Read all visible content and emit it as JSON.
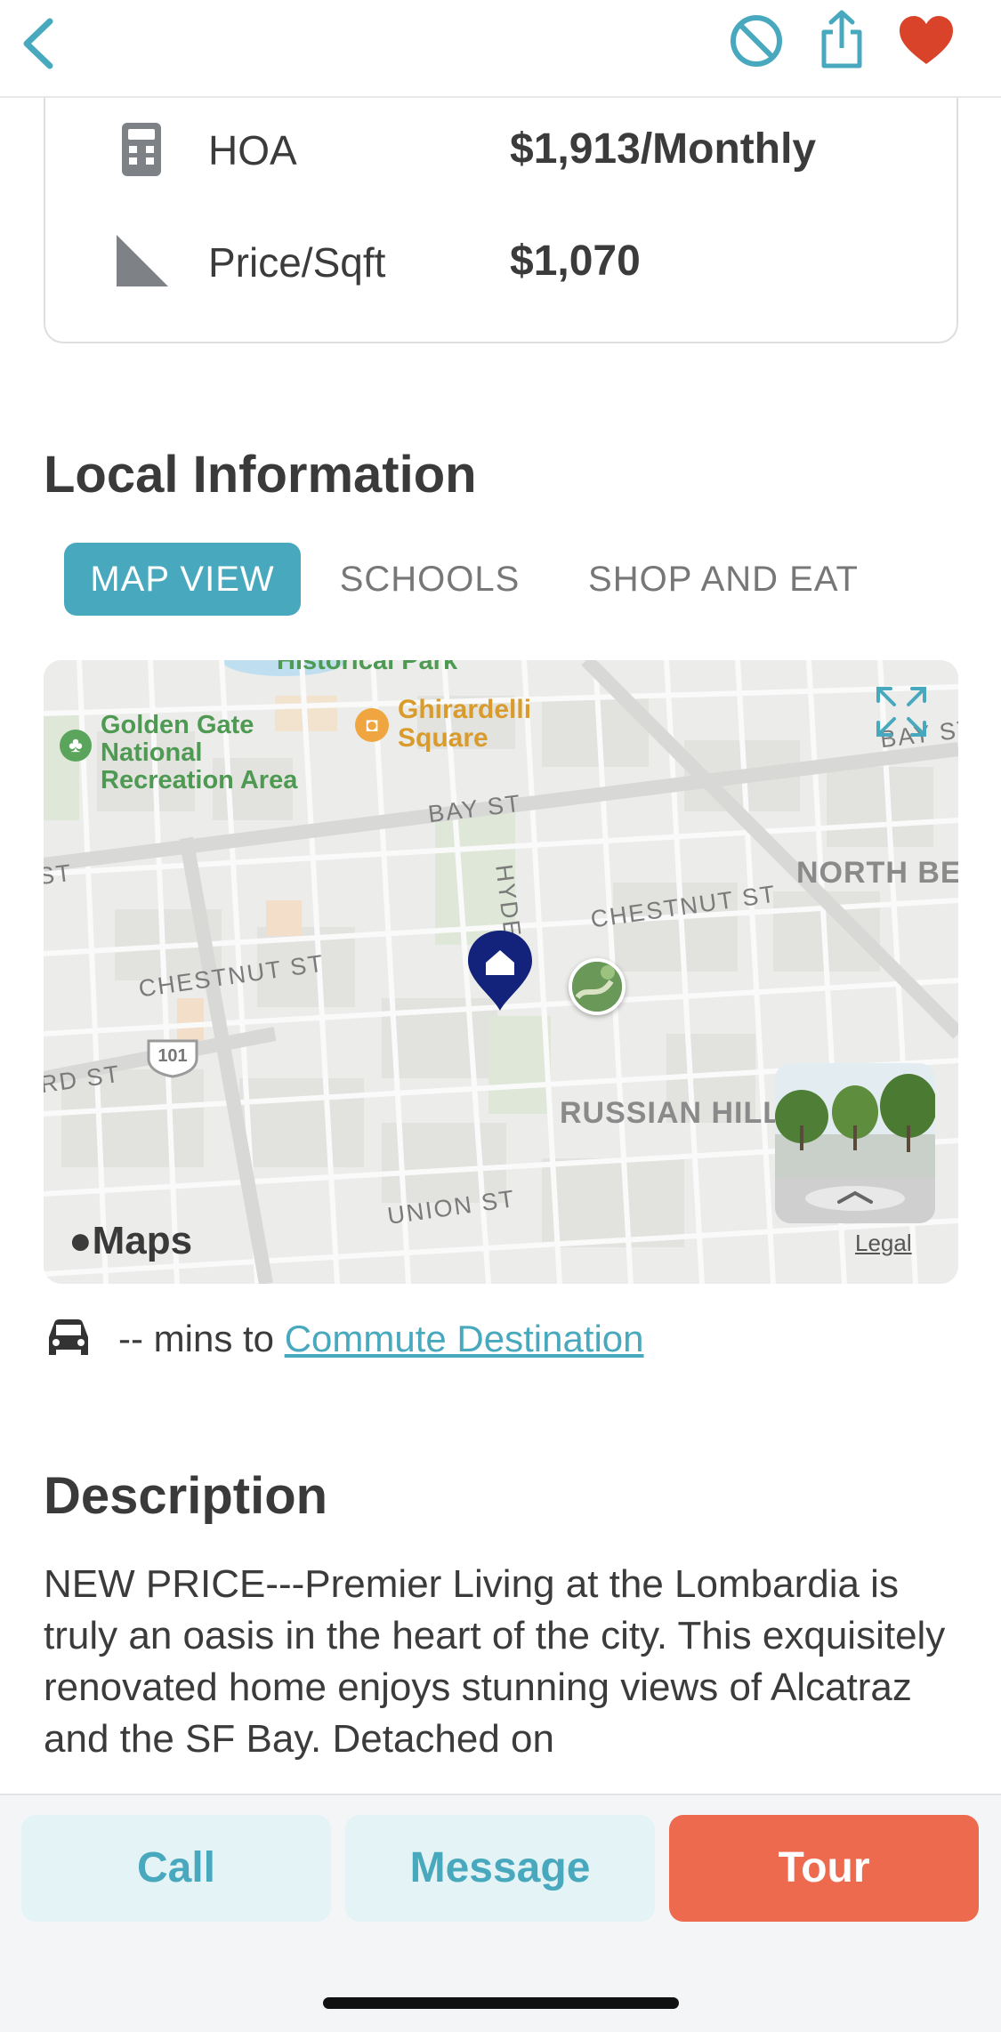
{
  "nav": {
    "back_icon": "chevron-left-icon",
    "block_icon": "block-icon",
    "share_icon": "share-icon",
    "favorite_icon": "heart-icon",
    "accent_color": "#48a9be",
    "favorite_color": "#d9432a"
  },
  "details": {
    "rows": [
      {
        "icon": "calculator-icon",
        "label": "HOA",
        "value": "$1,913/Monthly"
      },
      {
        "icon": "ruler-triangle-icon",
        "label": "Price/Sqft",
        "value": "$1,070"
      }
    ]
  },
  "local_info": {
    "title": "Local Information",
    "tabs": [
      {
        "label": "MAP VIEW",
        "active": true
      },
      {
        "label": "SCHOOLS",
        "active": false
      },
      {
        "label": "SHOP AND EAT",
        "active": false
      }
    ]
  },
  "map": {
    "labels": {
      "historical_park": "Historical Park",
      "golden_gate": [
        "Golden Gate",
        "National",
        "Recreation Area"
      ],
      "ghirardelli": [
        "Ghirardelli",
        "Square"
      ],
      "bay_st": "BAY ST",
      "bay_st_right": "BAY ST",
      "st_left": "ST",
      "hyde_st": "HYDE ST",
      "chestnut_st_right": "CHESTNUT ST",
      "chestnut_st_left": "CHESTNUT ST",
      "north_beach": "NORTH BEA",
      "rd_st": "RD ST",
      "shield": "101",
      "russian_hill": "RUSSIAN HILL",
      "union_st": "UNION ST"
    },
    "maps_logo": "Maps",
    "legal": "Legal",
    "expand_icon": "expand-icon",
    "pin_icon": "home-pin-icon"
  },
  "commute": {
    "icon": "car-icon",
    "text": "-- mins to ",
    "link": "Commute Destination"
  },
  "description": {
    "title": "Description",
    "text": "NEW PRICE---Premier Living at the Lombardia is truly an oasis in the heart of the city.  This exquisitely renovated home enjoys stunning views of Alcatraz and the SF Bay.  Detached on"
  },
  "actions": {
    "call": "Call",
    "message": "Message",
    "tour": "Tour",
    "tour_color": "#ed6a4f"
  }
}
